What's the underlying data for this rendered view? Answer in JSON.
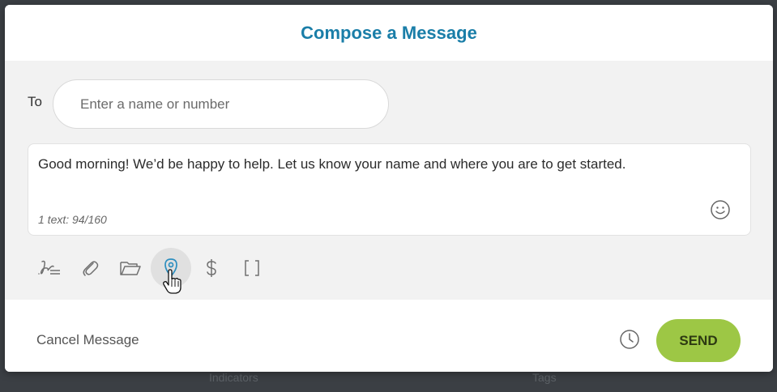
{
  "backdrop": {
    "left_text": "Indicators",
    "right_text": "Tags"
  },
  "modal": {
    "title": "Compose a Message"
  },
  "recipient": {
    "label": "To",
    "placeholder": "Enter a name or number",
    "value": ""
  },
  "message": {
    "body": "Good morning! We’d be happy to help. Let us know your name and where you are to get started.",
    "count": "1 text: 94/160"
  },
  "toolbar": {
    "tools": [
      {
        "icon": "signature-icon",
        "active": false
      },
      {
        "icon": "paperclip-icon",
        "active": false
      },
      {
        "icon": "folder-icon",
        "active": false
      },
      {
        "icon": "location-pin-icon",
        "active": true
      },
      {
        "icon": "dollar-icon",
        "active": false
      },
      {
        "icon": "brackets-icon",
        "active": false
      }
    ]
  },
  "footer": {
    "cancel_label": "Cancel Message",
    "send_label": "SEND",
    "schedule_icon": "clock-icon"
  },
  "colors": {
    "title": "#1a7ea8",
    "send_button": "#9dc745",
    "active_tool_icon": "#2e8fc0"
  }
}
